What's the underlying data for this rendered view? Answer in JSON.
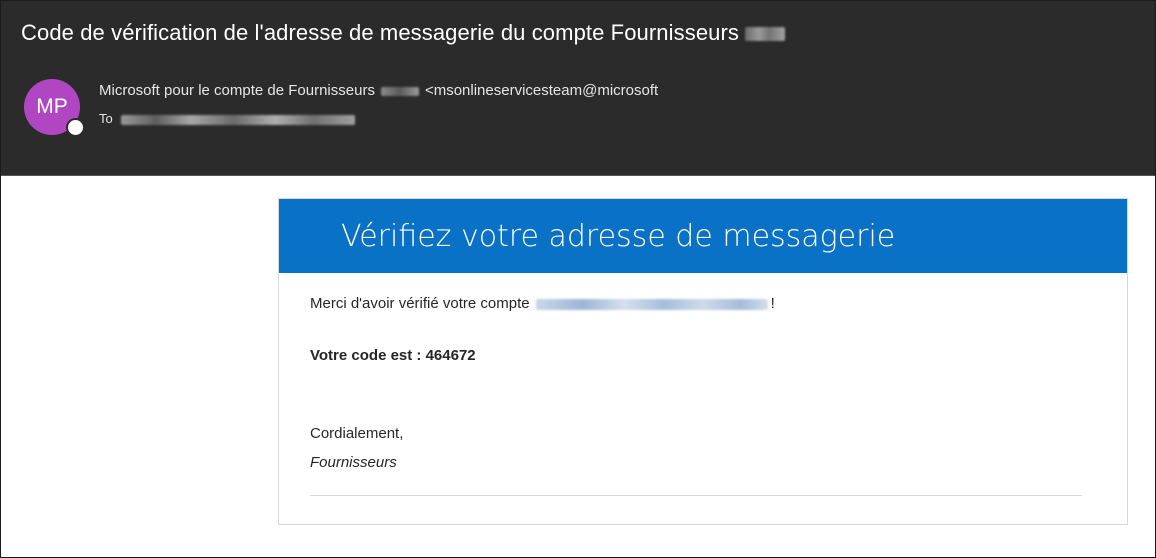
{
  "email": {
    "subject": "Code de vérification de l'adresse de messagerie du compte Fournisseurs",
    "avatar_initials": "MP",
    "from_prefix": "Microsoft pour le compte de Fournisseurs",
    "from_address": "<msonlineservicesteam@microsoft",
    "to_label": "To"
  },
  "message": {
    "banner_title": "Vérifiez votre adresse de messagerie",
    "thanks_prefix": "Merci d'avoir vérifié votre compte",
    "thanks_suffix": "!",
    "code_line": "Votre code est : 464672",
    "closing": "Cordialement,",
    "signature": "Fournisseurs"
  },
  "colors": {
    "header_bg": "#2b2b2b",
    "avatar_bg": "#b146c2",
    "banner_bg": "#0a72c6"
  }
}
